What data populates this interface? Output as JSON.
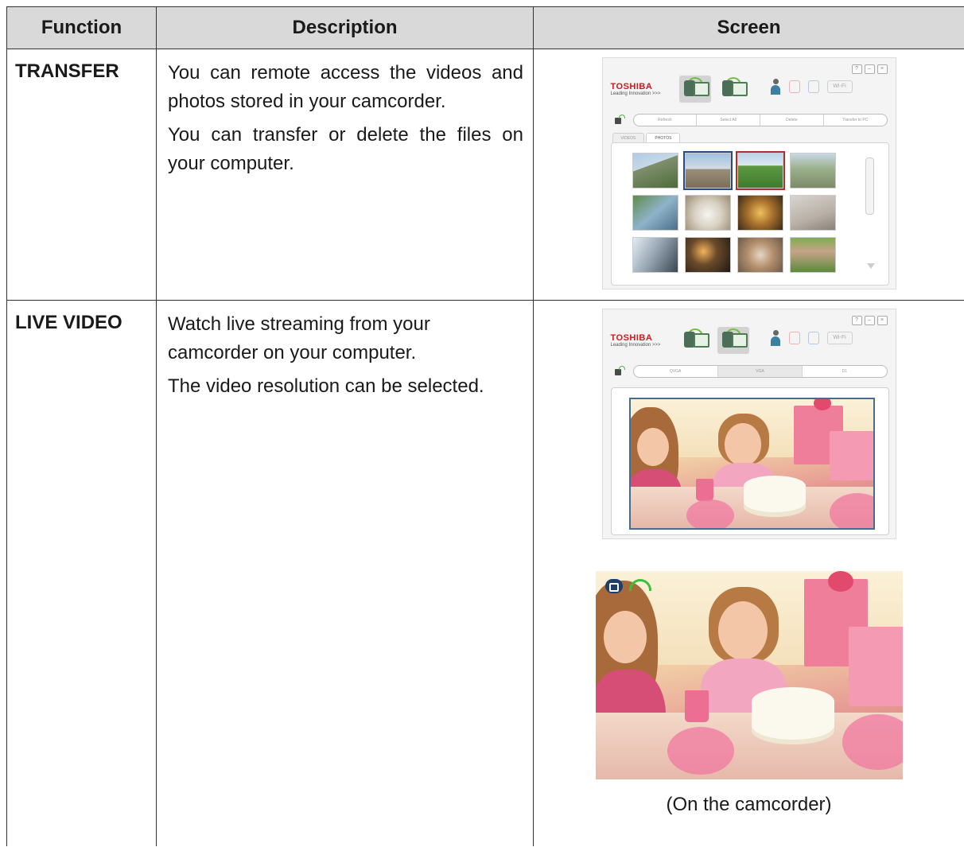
{
  "table": {
    "headers": {
      "function": "Function",
      "description": "Description",
      "screen": "Screen"
    },
    "rows": [
      {
        "function": "TRANSFER",
        "description": [
          "You can remote access the videos and photos stored in your camcorder.",
          "You can transfer or delete the files on your computer."
        ]
      },
      {
        "function": "LIVE VIDEO",
        "description": [
          "Watch live streaming from your camcorder on your computer.",
          "The video resolution can be selected."
        ],
        "screen_caption": "(On the camcorder)"
      }
    ]
  },
  "app": {
    "brand": "TOSHIBA",
    "brand_tag": "Leading Innovation >>>",
    "wifi_badge": "Wi-Fi",
    "transfer_tabs": [
      "VIDEOS",
      "PHOTOS"
    ],
    "transfer_actions": [
      "Refresh",
      "Select All",
      "Delete",
      "Transfer to PC"
    ],
    "live_resolutions": [
      "QVGA",
      "VGA",
      "D1"
    ],
    "accent_color": "#d4161c",
    "selection_colors": {
      "blue": "#2a4a8c",
      "red": "#b03030"
    }
  }
}
